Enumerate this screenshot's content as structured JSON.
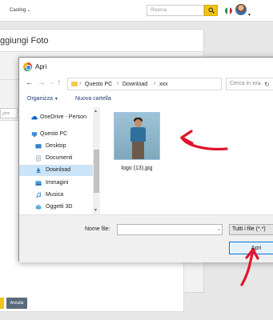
{
  "page": {
    "nav_item": "Casting",
    "search_placeholder": "Ricerca",
    "panel_title": "ggiungi Foto",
    "input_fragment": "gine",
    "cancel_label": "Annulla"
  },
  "dialog": {
    "title": "Apri",
    "breadcrumbs": [
      "Questo PC",
      "Download",
      "xxx"
    ],
    "search_placeholder": "Cerca in xxx",
    "toolbar": {
      "organize": "Organizza",
      "new_folder": "Nuova cartella"
    },
    "nav_items": [
      {
        "label": "OneDrive - Person",
        "icon": "cloud-icon"
      },
      {
        "label": "Questo PC",
        "icon": "computer-icon"
      },
      {
        "label": "Desktop",
        "icon": "desktop-icon"
      },
      {
        "label": "Documenti",
        "icon": "documents-icon"
      },
      {
        "label": "Download",
        "icon": "download-icon",
        "selected": true
      },
      {
        "label": "Immagini",
        "icon": "images-icon"
      },
      {
        "label": "Musica",
        "icon": "music-icon"
      },
      {
        "label": "Oggetti 3D",
        "icon": "cube-icon"
      }
    ],
    "file": {
      "name": "logo (13).jpg"
    },
    "filename_label": "Nome file:",
    "filename_value": "",
    "filetype": "Tutti i file (*.*)",
    "open_label": "Apri"
  },
  "colors": {
    "accent_yellow": "#f0c316",
    "selection": "#cce4f7",
    "annotation_red": "#e0152b",
    "primary_border": "#0078d7"
  }
}
